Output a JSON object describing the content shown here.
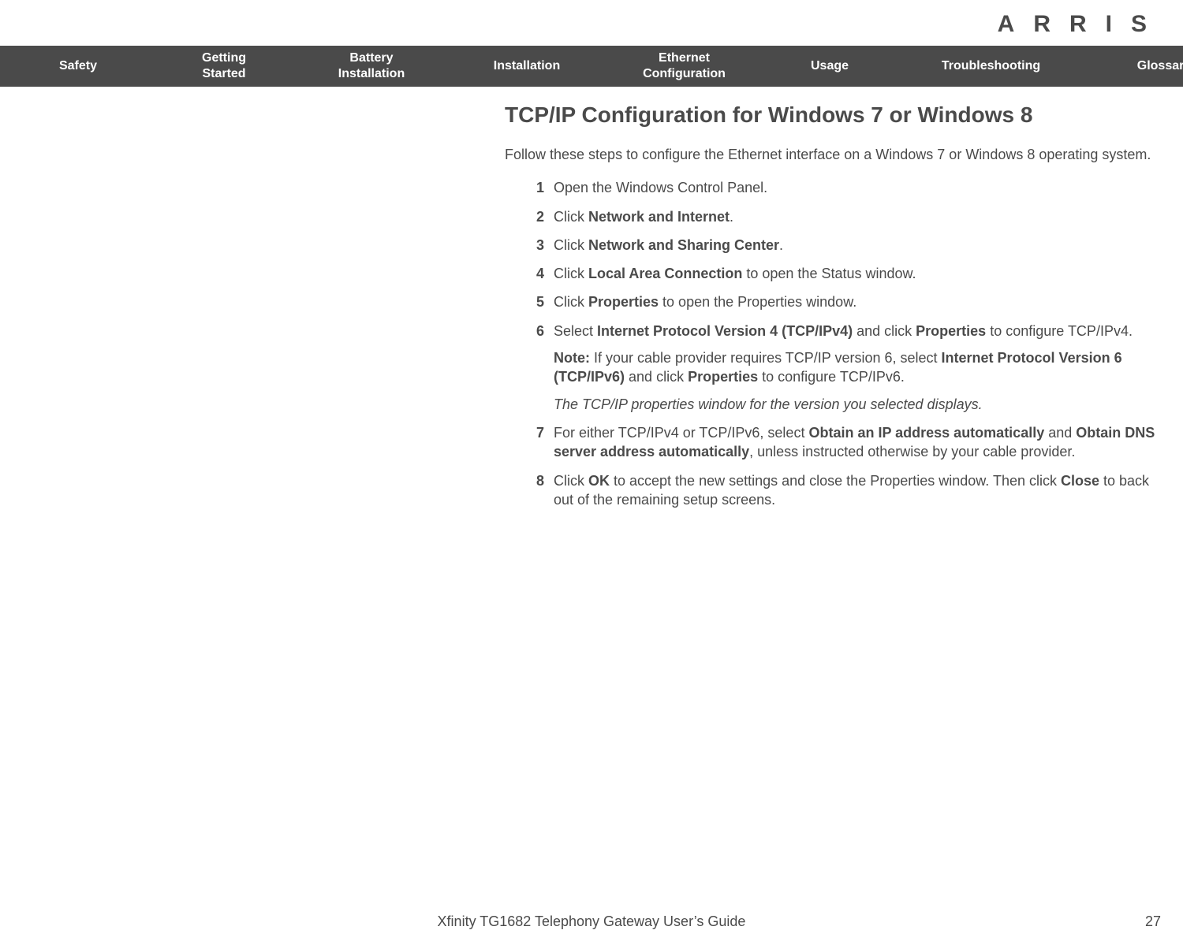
{
  "brand": "ARRIS",
  "nav": {
    "safety": "Safety",
    "getting_started": "Getting\nStarted",
    "battery_installation": "Battery\nInstallation",
    "installation": "Installation",
    "ethernet_configuration": "Ethernet\nConfiguration",
    "usage": "Usage",
    "troubleshooting": "Troubleshooting",
    "glossary": "Glossary"
  },
  "page": {
    "heading": "TCP/IP Configuration for Windows 7 or Windows 8",
    "intro": "Follow these steps to configure the Ethernet interface on a Windows 7 or Windows 8 operating system.",
    "steps": {
      "s1": "Open the Windows Control Panel.",
      "s2_pre": "Click ",
      "s2_b1": "Network and Internet",
      "s2_post": ".",
      "s3_pre": "Click ",
      "s3_b1": "Network and Sharing Center",
      "s3_post": ".",
      "s4_pre": "Click ",
      "s4_b1": "Local Area Connection",
      "s4_post": " to open the Status window.",
      "s5_pre": "Click ",
      "s5_b1": "Properties",
      "s5_post": " to open the Properties window.",
      "s6_pre": "Select ",
      "s6_b1": "Internet Protocol Version 4 (TCP/IPv4)",
      "s6_mid": " and click ",
      "s6_b2": "Properties",
      "s6_post": " to configure TCP/IPv4.",
      "s6_note_label": "Note:",
      "s6_note_pre": " If your cable provider requires TCP/IP version 6, select ",
      "s6_note_b1": "Internet Protocol Version 6 (TCP/IPv6)",
      "s6_note_mid": " and click ",
      "s6_note_b2": "Properties",
      "s6_note_post": " to configure TCP/IPv6.",
      "s6_result": "The TCP/IP properties window for the version you selected displays.",
      "s7_pre": "For either TCP/IPv4 or TCP/IPv6, select ",
      "s7_b1": "Obtain an IP address automatically",
      "s7_mid": " and ",
      "s7_b2": "Obtain DNS server address automatically",
      "s7_post": ", unless instructed otherwise by your cable provider.",
      "s8_pre": "Click ",
      "s8_b1": "OK",
      "s8_mid": " to accept the new settings and close the Properties window. Then click ",
      "s8_b2": "Close",
      "s8_post": " to back out of the remaining setup screens."
    }
  },
  "footer": {
    "title": "Xfinity TG1682 Telephony Gateway User’s Guide",
    "page_number": "27"
  }
}
